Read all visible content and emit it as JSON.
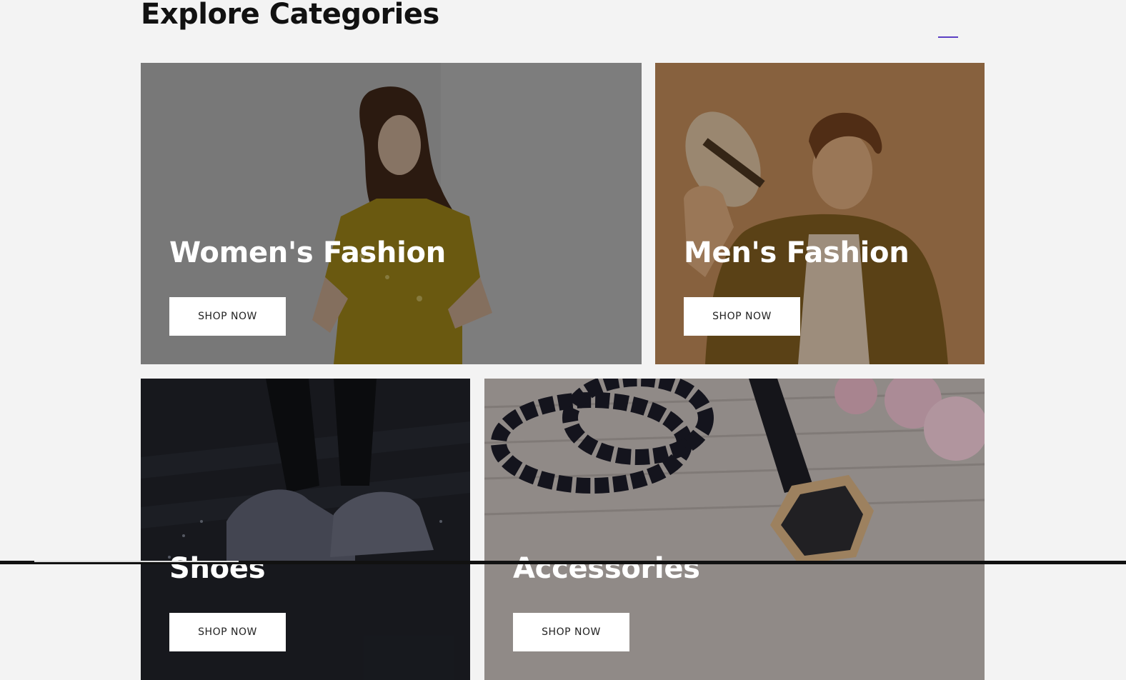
{
  "section": {
    "title": "Explore Categories"
  },
  "cards": [
    {
      "title": "Women's Fashion",
      "button": "SHOP NOW"
    },
    {
      "title": "Men's Fashion",
      "button": "SHOP NOW"
    },
    {
      "title": "Shoes",
      "button": "SHOP NOW"
    },
    {
      "title": "Accessories",
      "button": "SHOP NOW"
    }
  ],
  "colors": {
    "accent": "#5b3fc4",
    "background": "#f3f3f3",
    "button_bg": "#ffffff"
  }
}
